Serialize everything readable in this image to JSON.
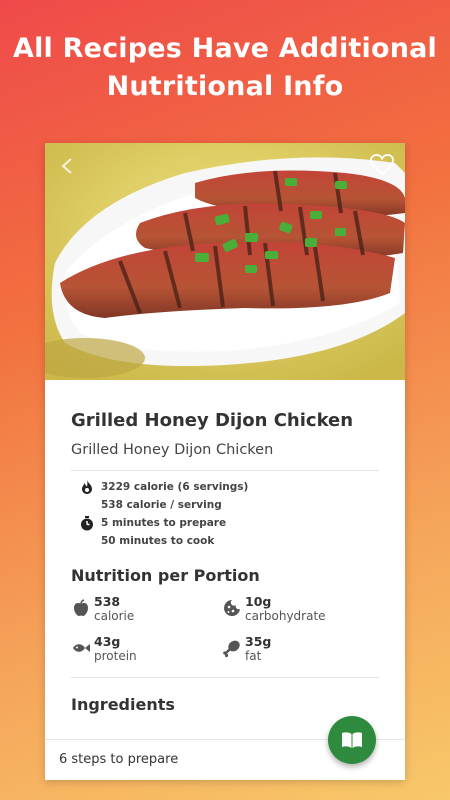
{
  "promo": {
    "line1": "All Recipes Have Additional",
    "line2": "Nutritional Info"
  },
  "recipe": {
    "title": "Grilled Honey Dijon Chicken",
    "subtitle": "Grilled Honey Dijon Chicken",
    "favorite_icon": "heart-outline-icon"
  },
  "info": {
    "total_calories": "3229 calorie (6 servings)",
    "per_serving": "538 calorie / serving",
    "prep_time": "5 minutes to prepare",
    "cook_time": "50 minutes to cook"
  },
  "nutrition": {
    "title": "Nutrition per Portion",
    "items": [
      {
        "value": "538",
        "label": "calorie",
        "icon": "apple-icon"
      },
      {
        "value": "10g",
        "label": "carbohydrate",
        "icon": "cookie-icon"
      },
      {
        "value": "43g",
        "label": "protein",
        "icon": "fish-icon"
      },
      {
        "value": "35g",
        "label": "fat",
        "icon": "drumstick-icon"
      }
    ]
  },
  "ingredients": {
    "title": "Ingredients"
  },
  "footer": {
    "steps_text": "6 steps to prepare"
  },
  "colors": {
    "accent_green": "#2e8b3e",
    "gradient_top": "#ef4a4a",
    "gradient_bottom": "#f8c86a"
  }
}
